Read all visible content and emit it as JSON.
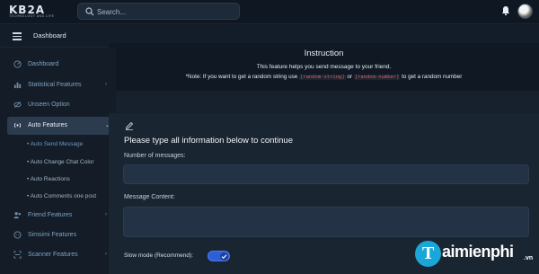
{
  "brand": {
    "logo_text": "KB2A",
    "logo_sub": "TECHNOLOGY AND LIFE"
  },
  "search": {
    "placeholder": "Search..."
  },
  "header": {
    "breadcrumb": "Dashboard"
  },
  "sidebar": {
    "items": [
      {
        "label": "Dashboard",
        "icon": "gauge-icon"
      },
      {
        "label": "Statistical Features",
        "icon": "chart-icon",
        "chevron": "›"
      },
      {
        "label": "Unseen Option",
        "icon": "eye-off-icon"
      },
      {
        "label": "Auto Features",
        "icon": "broadcast-icon",
        "chevron": "⌄"
      },
      {
        "label": "Friend Features",
        "icon": "users-icon",
        "chevron": "›"
      },
      {
        "label": "Simsimi Features",
        "icon": "chat-icon"
      },
      {
        "label": "Scanner Features",
        "icon": "scan-icon",
        "chevron": "›"
      }
    ],
    "sub_items": [
      "• Auto Send Message",
      "• Auto Change Chat Color",
      "• Auto Reactions",
      "• Auto Comments one post"
    ]
  },
  "instruction": {
    "title": "Instruction",
    "line1": "This feature helps you send message to your friend.",
    "line2_prefix": "*Note: If you want to get a random string use",
    "code_string": "[random-string]",
    "line2_or": "or",
    "code_number": "[random-number]",
    "line2_suffix": "to get a random number"
  },
  "form": {
    "title": "Please type all information below to continue",
    "messages_label": "Number of messages:",
    "messages_value": "",
    "content_label": "Message Content:",
    "content_value": "",
    "slow_mode_label": "Slow mode (Recommend):",
    "slow_mode_on": true
  },
  "watermark": {
    "text": "aimienphi",
    "suffix": ".vn",
    "logo_letter": "T"
  },
  "colors": {
    "accent": "#2f5fd6",
    "active_nav": "#2c3c4e",
    "code_red": "#e25b5b",
    "watermark": "#1aa7d8"
  }
}
